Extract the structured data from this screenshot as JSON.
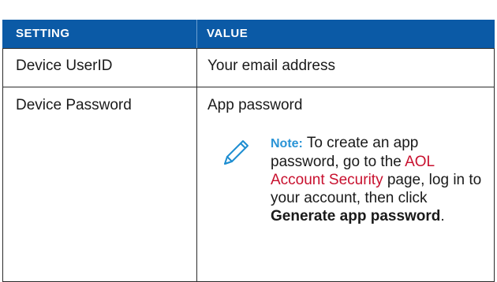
{
  "table": {
    "headers": [
      "SETTING",
      "VALUE"
    ],
    "rows": [
      {
        "setting": "Device UserID",
        "value": "Your email address"
      },
      {
        "setting": "Device Password",
        "value": "App password"
      }
    ]
  },
  "note": {
    "label": "Note:",
    "text_before_link": "To create an app password, go to the",
    "link_text": "AOL Account Security",
    "text_after_link": "page, log in to your account, then click",
    "bold_action": "Generate app password",
    "end": ".",
    "icon": "pencil-icon",
    "icon_color": "#1e8ed1"
  },
  "colors": {
    "header_bg": "#0b5aa6",
    "header_text": "#ffffff",
    "link": "#c8102e",
    "note_label": "#2a94d6"
  }
}
